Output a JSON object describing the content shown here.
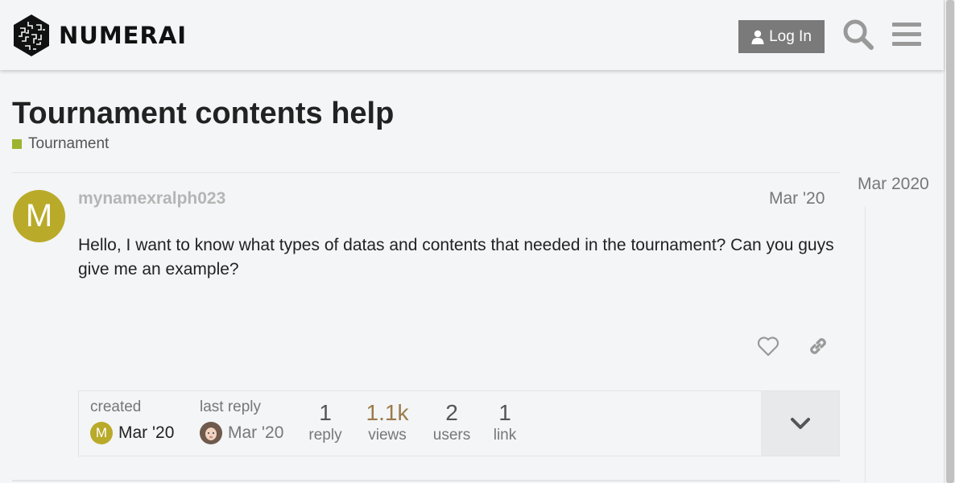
{
  "header": {
    "logo_text": "NUMERAI",
    "login_label": "Log In",
    "search_icon": "search-icon",
    "menu_icon": "hamburger-icon"
  },
  "topic": {
    "title": "Tournament contents help",
    "category": "Tournament",
    "category_color": "#9ab42f"
  },
  "post": {
    "avatar_letter": "M",
    "avatar_color": "#b9aa2a",
    "username": "mynamexralph023",
    "date": "Mar '20",
    "body": "Hello, I want to know what types of datas and contents that needed in the tournament? Can you guys give me an example?"
  },
  "topic_map": {
    "created_label": "created",
    "created_avatar_letter": "M",
    "created_date": "Mar '20",
    "last_reply_label": "last reply",
    "last_reply_date": "Mar '20",
    "stats": [
      {
        "num": "1",
        "label": "reply"
      },
      {
        "num": "1.1k",
        "label": "views",
        "color": "#9c7a4a"
      },
      {
        "num": "2",
        "label": "users"
      },
      {
        "num": "1",
        "label": "link"
      }
    ]
  },
  "timeline": {
    "date": "Mar 2020"
  }
}
